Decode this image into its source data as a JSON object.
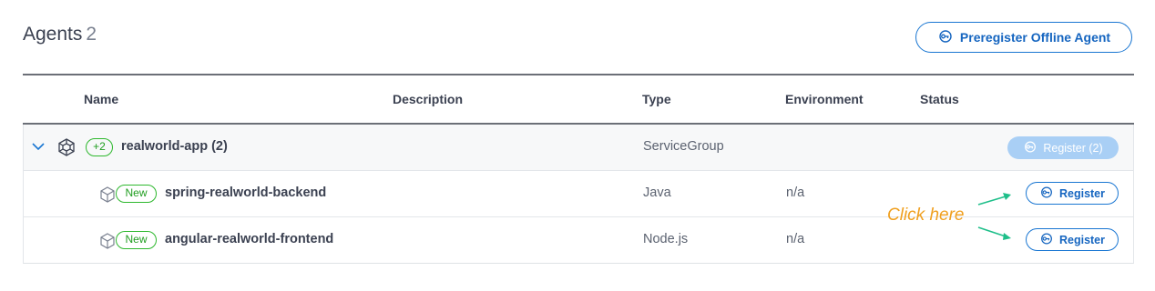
{
  "header": {
    "title": "Agents",
    "count": "2",
    "preregister_label": "Preregister Offline Agent"
  },
  "table": {
    "columns": {
      "name": "Name",
      "description": "Description",
      "type": "Type",
      "environment": "Environment",
      "status": "Status"
    },
    "group": {
      "badge": "+2",
      "name": "realworld-app (2)",
      "type": "ServiceGroup",
      "register_label": "Register (2)"
    },
    "rows": [
      {
        "badge": "New",
        "name": "spring-realworld-backend",
        "type": "Java",
        "environment": "n/a",
        "register_label": "Register"
      },
      {
        "badge": "New",
        "name": "angular-realworld-frontend",
        "type": "Node.js",
        "environment": "n/a",
        "register_label": "Register"
      }
    ]
  },
  "annotation": {
    "text": "Click here",
    "color": "#f0a020",
    "arrow_color": "#1fbf8a"
  },
  "colors": {
    "accent": "#1976d2",
    "new_badge": "#2eb82e",
    "disabled_button": "#a9cff5"
  }
}
